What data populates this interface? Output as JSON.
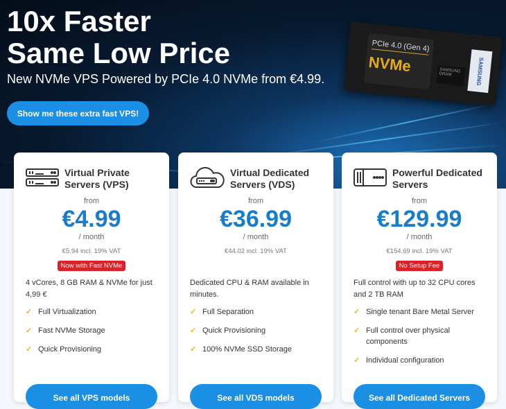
{
  "hero": {
    "title_line1": "10x Faster",
    "title_line2": "Same Low Price",
    "subtitle": "New NVMe VPS Powered by PCIe 4.0 NVMe from €4.99.",
    "cta": "Show me these extra fast VPS!",
    "ssd": {
      "pcie": "PCIe 4.0 (Gen 4)",
      "nvme": "NVMe",
      "brand": "SAMSUNG",
      "dram": "SAMSUNG DRAM"
    }
  },
  "colors": {
    "accent": "#1a8fe3",
    "price": "#1a7dc8",
    "badge": "#d9222a",
    "check": "#f0b323"
  },
  "cards": [
    {
      "icon": "server-rack-icon",
      "title": "Virtual Private Servers (VPS)",
      "from": "from",
      "price": "€4.99",
      "period": "/ month",
      "vat": "€5.94 incl. 19% VAT",
      "badge": "Now with Fast NVMe",
      "desc": "4 vCores, 8 GB RAM & NVMe for just 4,99 €",
      "features": [
        "Full Virtualization",
        "Fast NVMe Storage",
        "Quick Provisioning"
      ],
      "button": "See all VPS models"
    },
    {
      "icon": "cloud-server-icon",
      "title": "Virtual Dedicated Servers (VDS)",
      "from": "from",
      "price": "€36.99",
      "period": "/ month",
      "vat": "€44.02 incl. 19% VAT",
      "badge": "",
      "desc": "Dedicated CPU & RAM available in minutes.",
      "features": [
        "Full Separation",
        "Quick Provisioning",
        "100% NVMe SSD Storage"
      ],
      "button": "See all VDS models"
    },
    {
      "icon": "dedicated-server-icon",
      "title": "Powerful Dedicated Servers",
      "from": "from",
      "price": "€129.99",
      "period": "/ month",
      "vat": "€154.69 incl. 19% VAT",
      "badge": "No Setup Fee",
      "desc": "Full control with up to 32 CPU cores and 2 TB RAM",
      "features": [
        "Single tenant Bare Metal Server",
        "Full control over physical components",
        "Individual configuration"
      ],
      "button": "See all Dedicated Servers"
    }
  ]
}
